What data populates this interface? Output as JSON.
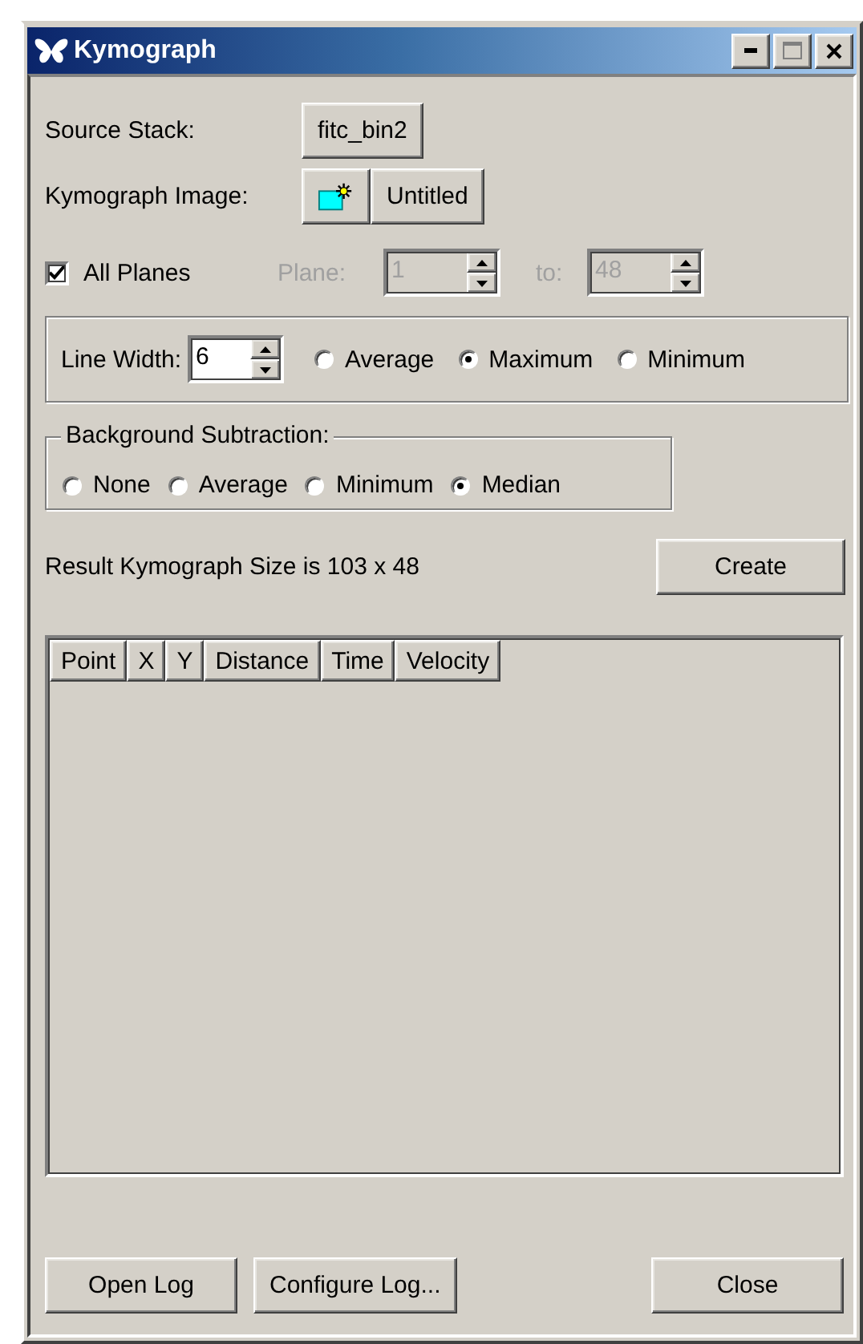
{
  "window": {
    "title": "Kymograph"
  },
  "source_stack": {
    "label": "Source Stack:",
    "button": "fitc_bin2"
  },
  "kymograph_image": {
    "label": "Kymograph Image:",
    "button": "Untitled"
  },
  "all_planes": {
    "label": "All Planes",
    "checked": true
  },
  "plane": {
    "label": "Plane:",
    "value": "1",
    "disabled": true
  },
  "to": {
    "label": "to:",
    "value": "48",
    "disabled": true
  },
  "line_width": {
    "label": "Line Width:",
    "value": "6",
    "options": [
      {
        "label": "Average",
        "selected": false
      },
      {
        "label": "Maximum",
        "selected": true
      },
      {
        "label": "Minimum",
        "selected": false
      }
    ]
  },
  "background_subtraction": {
    "title": "Background Subtraction:",
    "options": [
      {
        "label": "None",
        "selected": false
      },
      {
        "label": "Average",
        "selected": false
      },
      {
        "label": "Minimum",
        "selected": false
      },
      {
        "label": "Median",
        "selected": true
      }
    ]
  },
  "result": "Result Kymograph Size is 103 x 48",
  "create_button": "Create",
  "table": {
    "columns": [
      "Point",
      "X",
      "Y",
      "Distance",
      "Time",
      "Velocity"
    ]
  },
  "buttons": [
    {
      "label": "Open Log"
    },
    {
      "label": "Configure Log..."
    },
    {
      "label": "Close"
    }
  ]
}
